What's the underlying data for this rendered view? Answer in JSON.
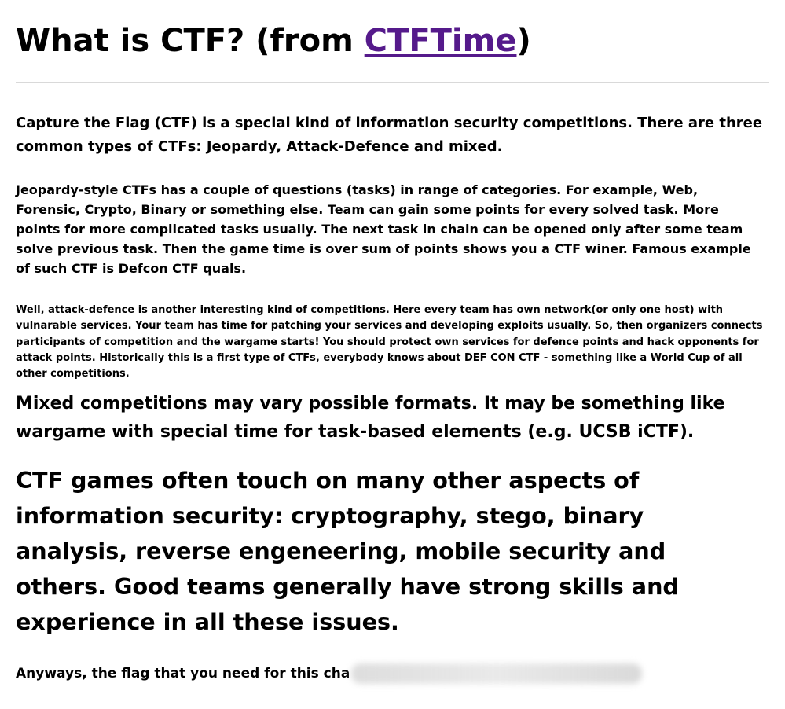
{
  "heading": {
    "prefix": "What is CTF? (from ",
    "link_text": "CTFTime",
    "suffix": ")"
  },
  "paragraphs": {
    "intro": "Capture the Flag (CTF) is a special kind of information security competitions. There are three common types of CTFs: Jeopardy, Attack-Defence and mixed.",
    "jeopardy": "Jeopardy-style CTFs has a couple of questions (tasks) in range of categories. For example, Web, Forensic, Crypto, Binary or something else. Team can gain some points for every solved task. More points for more complicated tasks usually. The next task in chain can be opened only after some team solve previous task. Then the game time is over sum of points shows you a CTF winer. Famous example of such CTF is Defcon CTF quals.",
    "attack_defence": "Well, attack-defence is another interesting kind of competitions. Here every team has own network(or only one host) with vulnarable services. Your team has time for patching your services and developing exploits usually. So, then organizers connects participants of competition and the wargame starts! You should protect own services for defence points and hack opponents for attack points. Historically this is a first type of CTFs, everybody knows about DEF CON CTF - something like a World Cup of all other competitions.",
    "mixed": "Mixed competitions may vary possible formats. It may be something like wargame with special time for task-based elements (e.g. UCSB iCTF).",
    "aspects": "CTF games often touch on many other aspects of information security: cryptography, stego, binary analysis, reverse engeneering, mobile security and others. Good teams generally have strong skills and experience in all these issues.",
    "flag_prefix": "Anyways, the flag that you need for this cha"
  },
  "colors": {
    "link_visited": "#551a8b",
    "rule": "#d9d9d9"
  }
}
